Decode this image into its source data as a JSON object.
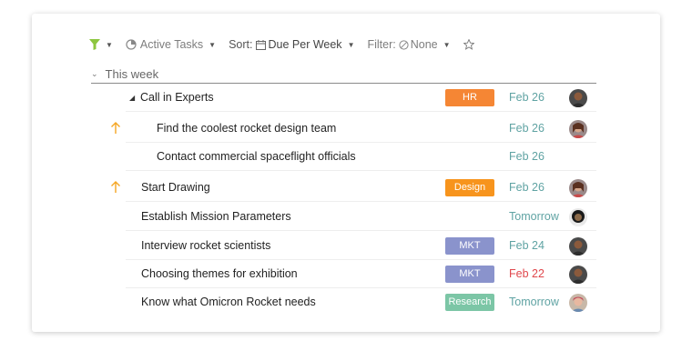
{
  "toolbar": {
    "filter_icon_color": "#8dc63f",
    "view_label": "Active Tasks",
    "sort_label": "Sort:",
    "sort_value": "Due Per Week",
    "filter_label": "Filter:",
    "filter_value": "None"
  },
  "group": {
    "label": "This week"
  },
  "tasks": [
    {
      "title": "Call in Experts",
      "tag": "HR",
      "tag_color": "#f58634",
      "date": "Feb 26",
      "overdue": false,
      "priority": false,
      "parent": true,
      "avatar": "avatar-1"
    },
    {
      "title": "Find the coolest rocket design team",
      "tag": "",
      "date": "Feb 26",
      "overdue": false,
      "priority": true,
      "subtask": true,
      "avatar": "avatar-2"
    },
    {
      "title": "Contact commercial spaceflight officials",
      "tag": "",
      "date": "Feb 26",
      "overdue": false,
      "priority": false,
      "subtask": true,
      "avatar": ""
    },
    {
      "title": "Start Drawing",
      "tag": "Design",
      "tag_color": "#f7941d",
      "date": "Feb 26",
      "overdue": false,
      "priority": true,
      "avatar": "avatar-2"
    },
    {
      "title": "Establish Mission Parameters",
      "tag": "",
      "date": "Tomorrow",
      "overdue": false,
      "priority": false,
      "avatar": "avatar-3"
    },
    {
      "title": "Interview rocket scientists",
      "tag": "MKT",
      "tag_color": "#8a93cc",
      "date": "Feb 24",
      "overdue": false,
      "priority": false,
      "avatar": "avatar-1"
    },
    {
      "title": "Choosing themes for exhibition",
      "tag": "MKT",
      "tag_color": "#8a93cc",
      "date": "Feb 22",
      "overdue": true,
      "priority": false,
      "avatar": "avatar-1"
    },
    {
      "title": "Know what Omicron Rocket needs",
      "tag": "Research",
      "tag_color": "#7cc6a6",
      "date": "Tomorrow",
      "overdue": false,
      "priority": false,
      "avatar": "avatar-4"
    }
  ],
  "colors": {
    "date": "#5fa3a3",
    "overdue": "#e0474c",
    "priority_arrow": "#f5a623"
  }
}
